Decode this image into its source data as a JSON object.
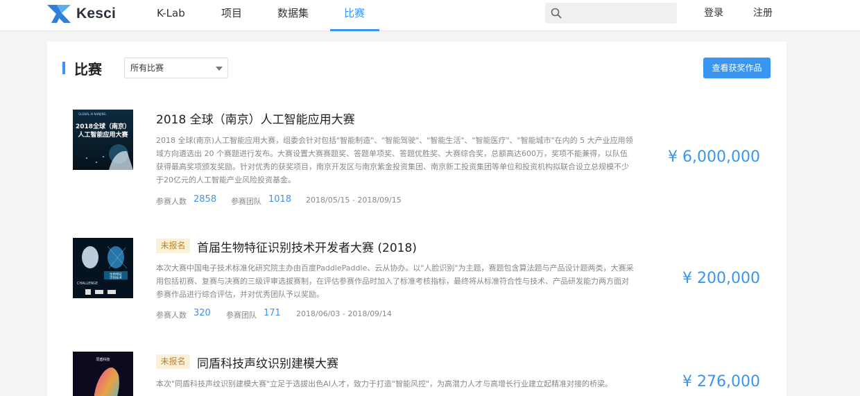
{
  "header": {
    "logo_text": "Kesci",
    "nav": [
      {
        "label": "K-Lab",
        "active": false
      },
      {
        "label": "项目",
        "active": false
      },
      {
        "label": "数据集",
        "active": false
      },
      {
        "label": "比赛",
        "active": true
      }
    ],
    "search": {
      "value": "",
      "placeholder": ""
    },
    "login_label": "登录",
    "register_label": "注册"
  },
  "page": {
    "title": "比赛",
    "filter": {
      "selected": "所有比赛"
    },
    "award_button": "查看获奖作品"
  },
  "competitions": [
    {
      "thumb_text": "2018全球（南京）人工智能应用大赛",
      "thumb_line1": "2018全球（南京）",
      "thumb_line2": "人工智能应用大赛",
      "thumb_logo": "GLOBAL AI NANJING",
      "status": "",
      "title": "2018 全球（南京）人工智能应用大赛",
      "description": "2018 全球(南京)人工智能应用大赛，组委会针对包括\"智能制造\"、\"智能驾驶\"、\"智能生活\"、\"智能医疗\"、\"智能城市\"在内的 5 大产业应用领域方向遴选出 20 个赛题进行发布。大赛设置大赛赛题奖、答题单项奖、答题优胜奖、大赛综合奖，总额高达600万，奖项不能兼得，以队伍获得最高奖项颁发奖励。针对优秀的获奖项目，南京开发区与南京紫金投资集团、南京新工投资集团等单位和投资机构拟联合设立总规模不少于20亿元的人工智能产业风险投资基金。",
      "participants_label": "参赛人数",
      "participants": "2858",
      "teams_label": "参赛团队",
      "teams": "1018",
      "dates": "2018/05/15 - 2018/09/15",
      "prize": "¥ 6,000,000"
    },
    {
      "thumb_text": "CHALLENGE",
      "thumb_line1": "生物特征",
      "thumb_line2": "识别技术",
      "thumb_logo": "CHALLENGE",
      "status": "未报名",
      "title": "首届生物特征识别技术开发者大赛 (2018)",
      "description": "本次大赛中国电子技术标准化研究院主办由百度PaddlePaddle、云从协办。以\"人脸识别\"为主题，赛题包含算法题与产品设计题两类，大赛采用包括初赛、复赛与决赛的三级评审选拔赛制，在评估参赛作品时加入了标准考核指标，最终将从标准符合性与技术、产品研发能力两方面对参赛作品进行综合评估，并对优秀团队予以奖励。",
      "participants_label": "参赛人数",
      "participants": "320",
      "teams_label": "参赛团队",
      "teams": "171",
      "dates": "2018/06/03 - 2018/09/14",
      "prize": "¥ 200,000"
    },
    {
      "thumb_text": "同盾科技",
      "thumb_line1": "",
      "thumb_line2": "",
      "thumb_logo": "同盾科技",
      "status": "未报名",
      "title": "同盾科技声纹识别建模大赛",
      "description": "本次\"同盾科技声纹识别建模大赛\"立足于选拔出色AI人才，致力于打造\"智能风控\"，为高潜力人才与高增长行业建立起精准对接的桥梁。",
      "participants_label": "",
      "participants": "",
      "teams_label": "",
      "teams": "",
      "dates": "",
      "prize": "¥ 276,000"
    }
  ],
  "colors": {
    "accent": "#3a95f0",
    "badge_bg": "#fbf0d8",
    "badge_text": "#b8862d"
  }
}
